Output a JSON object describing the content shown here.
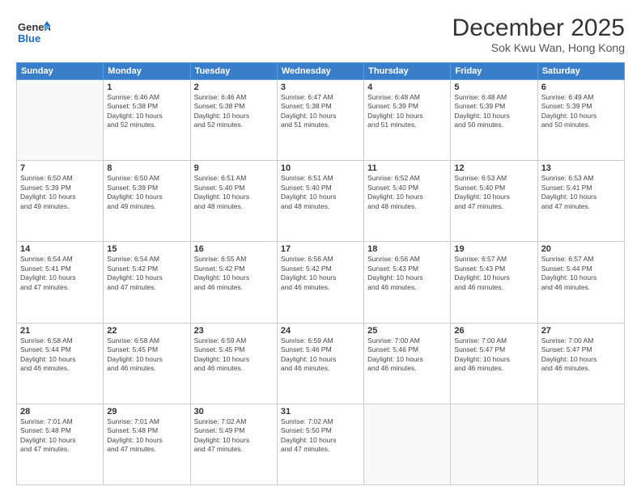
{
  "header": {
    "logo_general": "General",
    "logo_blue": "Blue",
    "title": "December 2025",
    "subtitle": "Sok Kwu Wan, Hong Kong"
  },
  "weekdays": [
    "Sunday",
    "Monday",
    "Tuesday",
    "Wednesday",
    "Thursday",
    "Friday",
    "Saturday"
  ],
  "weeks": [
    [
      {
        "day": "",
        "info": ""
      },
      {
        "day": "1",
        "info": "Sunrise: 6:46 AM\nSunset: 5:38 PM\nDaylight: 10 hours\nand 52 minutes."
      },
      {
        "day": "2",
        "info": "Sunrise: 6:46 AM\nSunset: 5:38 PM\nDaylight: 10 hours\nand 52 minutes."
      },
      {
        "day": "3",
        "info": "Sunrise: 6:47 AM\nSunset: 5:38 PM\nDaylight: 10 hours\nand 51 minutes."
      },
      {
        "day": "4",
        "info": "Sunrise: 6:48 AM\nSunset: 5:39 PM\nDaylight: 10 hours\nand 51 minutes."
      },
      {
        "day": "5",
        "info": "Sunrise: 6:48 AM\nSunset: 5:39 PM\nDaylight: 10 hours\nand 50 minutes."
      },
      {
        "day": "6",
        "info": "Sunrise: 6:49 AM\nSunset: 5:39 PM\nDaylight: 10 hours\nand 50 minutes."
      }
    ],
    [
      {
        "day": "7",
        "info": "Sunrise: 6:50 AM\nSunset: 5:39 PM\nDaylight: 10 hours\nand 49 minutes."
      },
      {
        "day": "8",
        "info": "Sunrise: 6:50 AM\nSunset: 5:39 PM\nDaylight: 10 hours\nand 49 minutes."
      },
      {
        "day": "9",
        "info": "Sunrise: 6:51 AM\nSunset: 5:40 PM\nDaylight: 10 hours\nand 48 minutes."
      },
      {
        "day": "10",
        "info": "Sunrise: 6:51 AM\nSunset: 5:40 PM\nDaylight: 10 hours\nand 48 minutes."
      },
      {
        "day": "11",
        "info": "Sunrise: 6:52 AM\nSunset: 5:40 PM\nDaylight: 10 hours\nand 48 minutes."
      },
      {
        "day": "12",
        "info": "Sunrise: 6:53 AM\nSunset: 5:40 PM\nDaylight: 10 hours\nand 47 minutes."
      },
      {
        "day": "13",
        "info": "Sunrise: 6:53 AM\nSunset: 5:41 PM\nDaylight: 10 hours\nand 47 minutes."
      }
    ],
    [
      {
        "day": "14",
        "info": "Sunrise: 6:54 AM\nSunset: 5:41 PM\nDaylight: 10 hours\nand 47 minutes."
      },
      {
        "day": "15",
        "info": "Sunrise: 6:54 AM\nSunset: 5:42 PM\nDaylight: 10 hours\nand 47 minutes."
      },
      {
        "day": "16",
        "info": "Sunrise: 6:55 AM\nSunset: 5:42 PM\nDaylight: 10 hours\nand 46 minutes."
      },
      {
        "day": "17",
        "info": "Sunrise: 6:56 AM\nSunset: 5:42 PM\nDaylight: 10 hours\nand 46 minutes."
      },
      {
        "day": "18",
        "info": "Sunrise: 6:56 AM\nSunset: 5:43 PM\nDaylight: 10 hours\nand 46 minutes."
      },
      {
        "day": "19",
        "info": "Sunrise: 6:57 AM\nSunset: 5:43 PM\nDaylight: 10 hours\nand 46 minutes."
      },
      {
        "day": "20",
        "info": "Sunrise: 6:57 AM\nSunset: 5:44 PM\nDaylight: 10 hours\nand 46 minutes."
      }
    ],
    [
      {
        "day": "21",
        "info": "Sunrise: 6:58 AM\nSunset: 5:44 PM\nDaylight: 10 hours\nand 46 minutes."
      },
      {
        "day": "22",
        "info": "Sunrise: 6:58 AM\nSunset: 5:45 PM\nDaylight: 10 hours\nand 46 minutes."
      },
      {
        "day": "23",
        "info": "Sunrise: 6:59 AM\nSunset: 5:45 PM\nDaylight: 10 hours\nand 46 minutes."
      },
      {
        "day": "24",
        "info": "Sunrise: 6:59 AM\nSunset: 5:46 PM\nDaylight: 10 hours\nand 46 minutes."
      },
      {
        "day": "25",
        "info": "Sunrise: 7:00 AM\nSunset: 5:46 PM\nDaylight: 10 hours\nand 46 minutes."
      },
      {
        "day": "26",
        "info": "Sunrise: 7:00 AM\nSunset: 5:47 PM\nDaylight: 10 hours\nand 46 minutes."
      },
      {
        "day": "27",
        "info": "Sunrise: 7:00 AM\nSunset: 5:47 PM\nDaylight: 10 hours\nand 46 minutes."
      }
    ],
    [
      {
        "day": "28",
        "info": "Sunrise: 7:01 AM\nSunset: 5:48 PM\nDaylight: 10 hours\nand 47 minutes."
      },
      {
        "day": "29",
        "info": "Sunrise: 7:01 AM\nSunset: 5:48 PM\nDaylight: 10 hours\nand 47 minutes."
      },
      {
        "day": "30",
        "info": "Sunrise: 7:02 AM\nSunset: 5:49 PM\nDaylight: 10 hours\nand 47 minutes."
      },
      {
        "day": "31",
        "info": "Sunrise: 7:02 AM\nSunset: 5:50 PM\nDaylight: 10 hours\nand 47 minutes."
      },
      {
        "day": "",
        "info": ""
      },
      {
        "day": "",
        "info": ""
      },
      {
        "day": "",
        "info": ""
      }
    ]
  ]
}
